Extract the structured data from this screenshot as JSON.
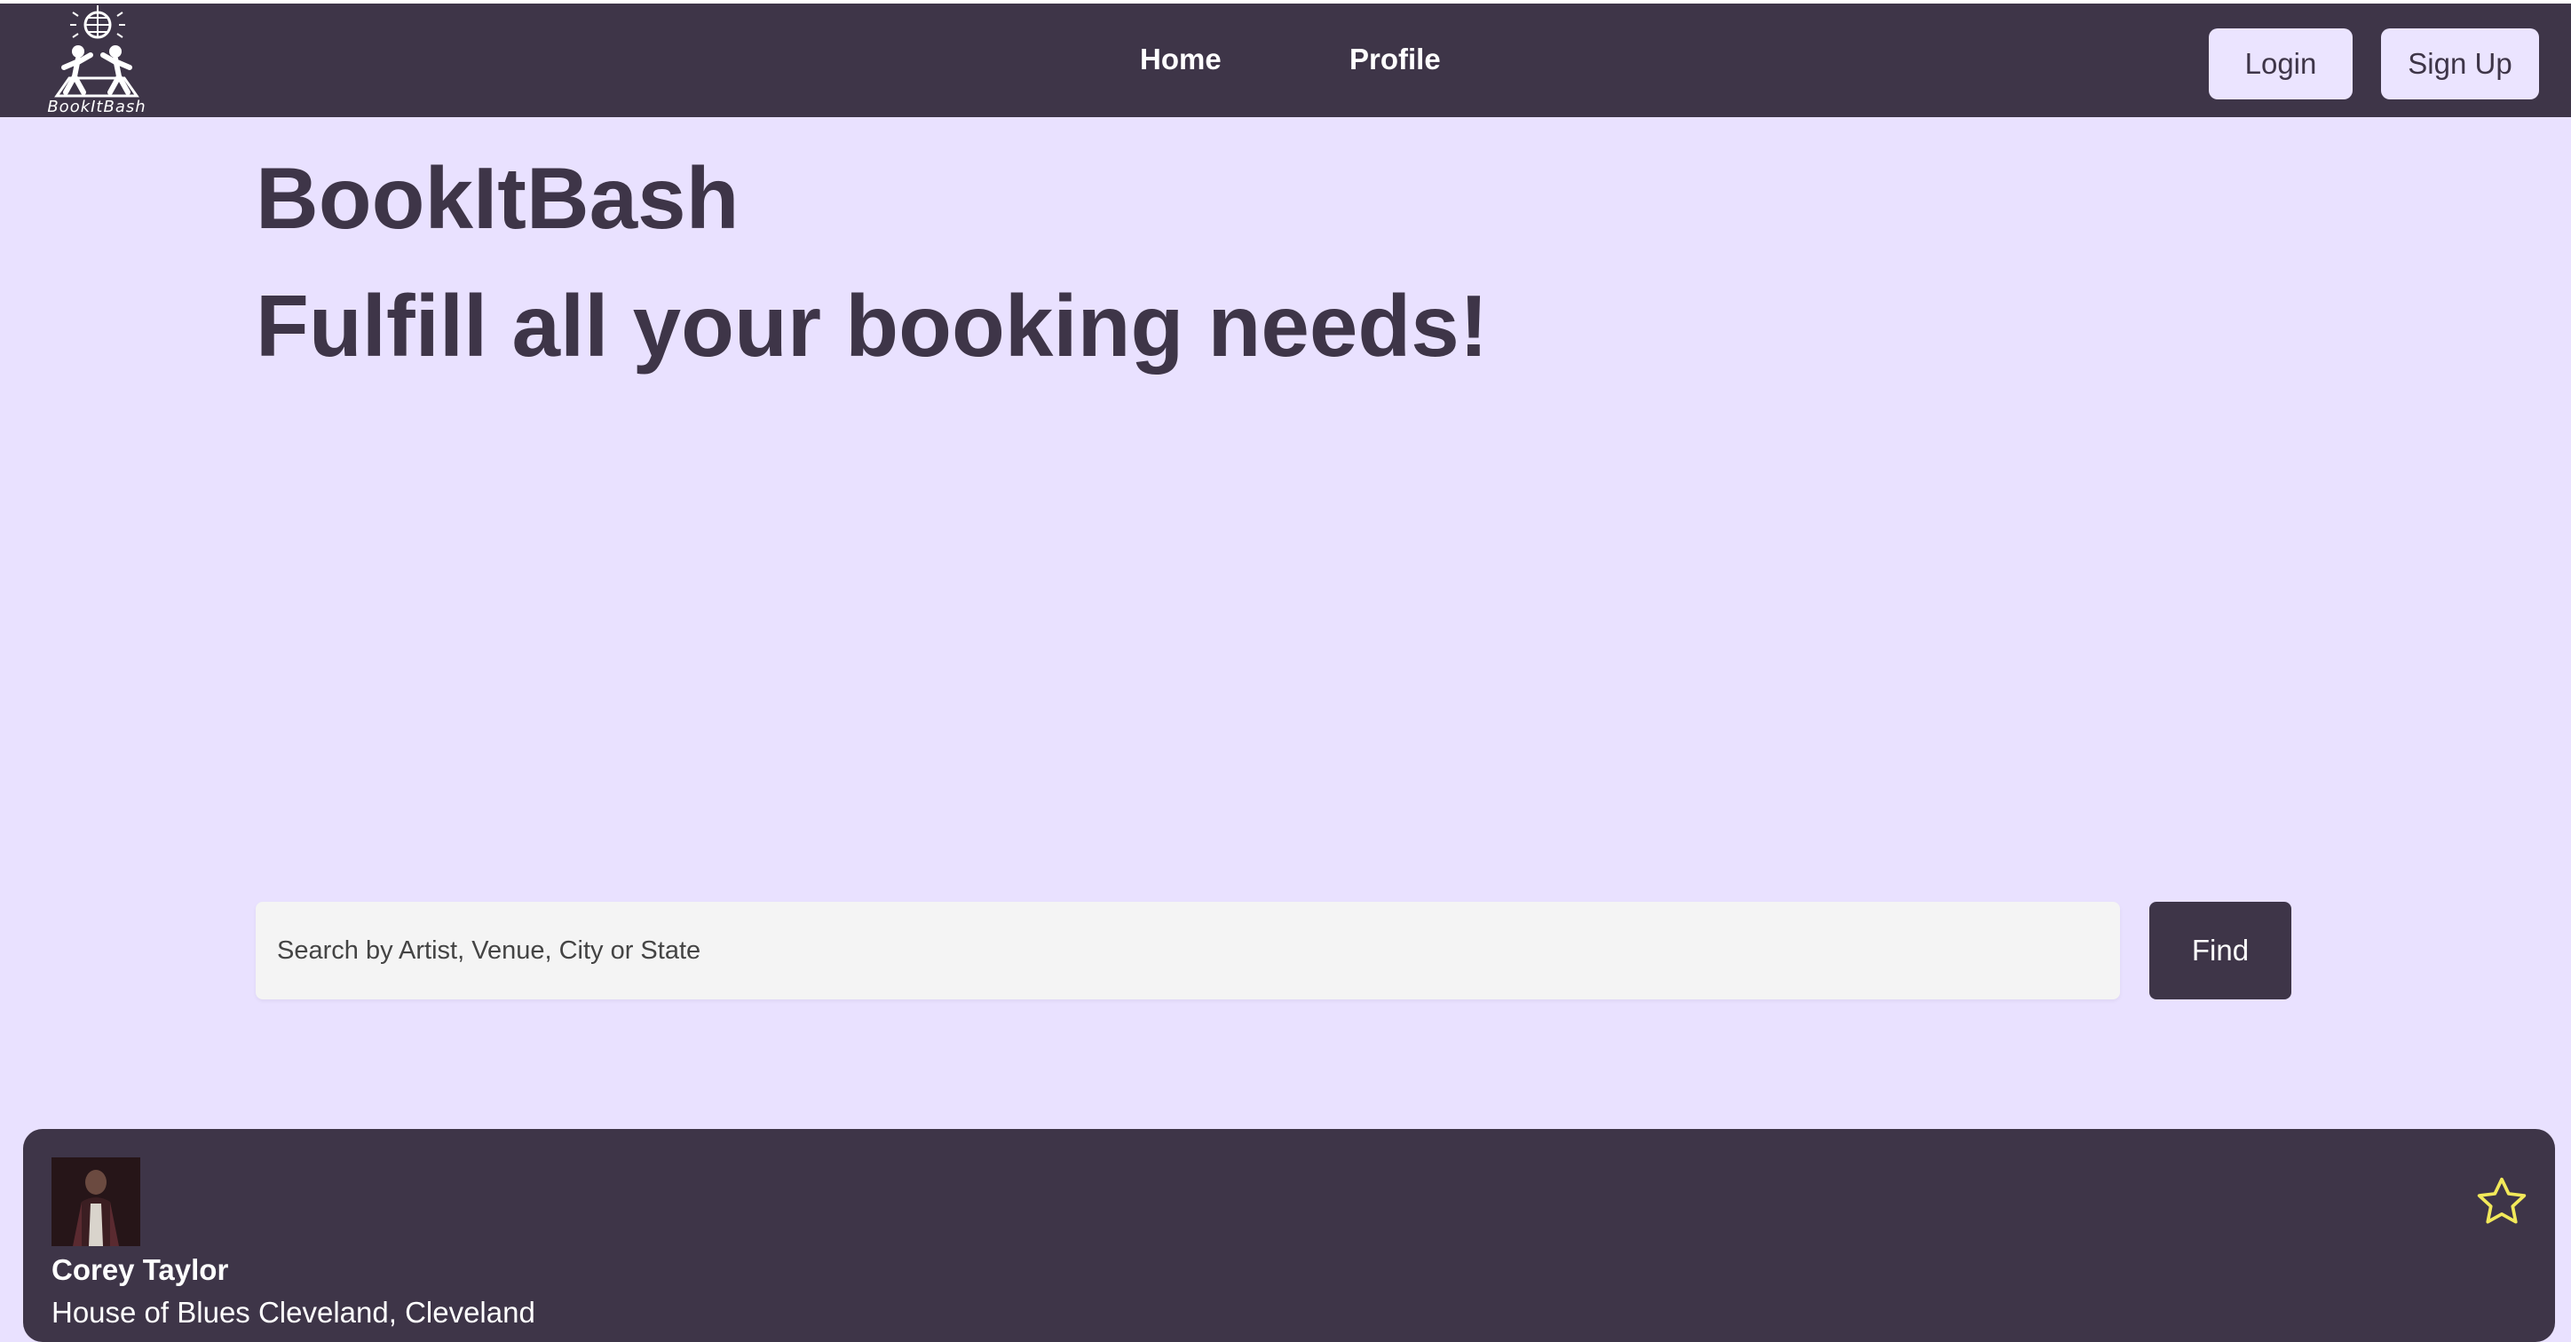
{
  "header": {
    "logo_text": "BookItBash",
    "nav": [
      {
        "label": "Home"
      },
      {
        "label": "Profile"
      }
    ],
    "login_label": "Login",
    "signup_label": "Sign Up"
  },
  "hero": {
    "title": "BookItBash",
    "tagline": "Fulfill all your booking needs!"
  },
  "search": {
    "placeholder": "Search by Artist, Venue, City or State",
    "value": "",
    "button_label": "Find"
  },
  "results": [
    {
      "artist": "Corey Taylor",
      "venue": "House of Blues Cleveland, Cleveland",
      "favorite_icon": "star-outline-icon",
      "favorited": false
    }
  ],
  "colors": {
    "primary": "#3e3548",
    "background": "#e9e1ff",
    "button_light": "#ebe4ff",
    "star": "#f2e95a"
  }
}
